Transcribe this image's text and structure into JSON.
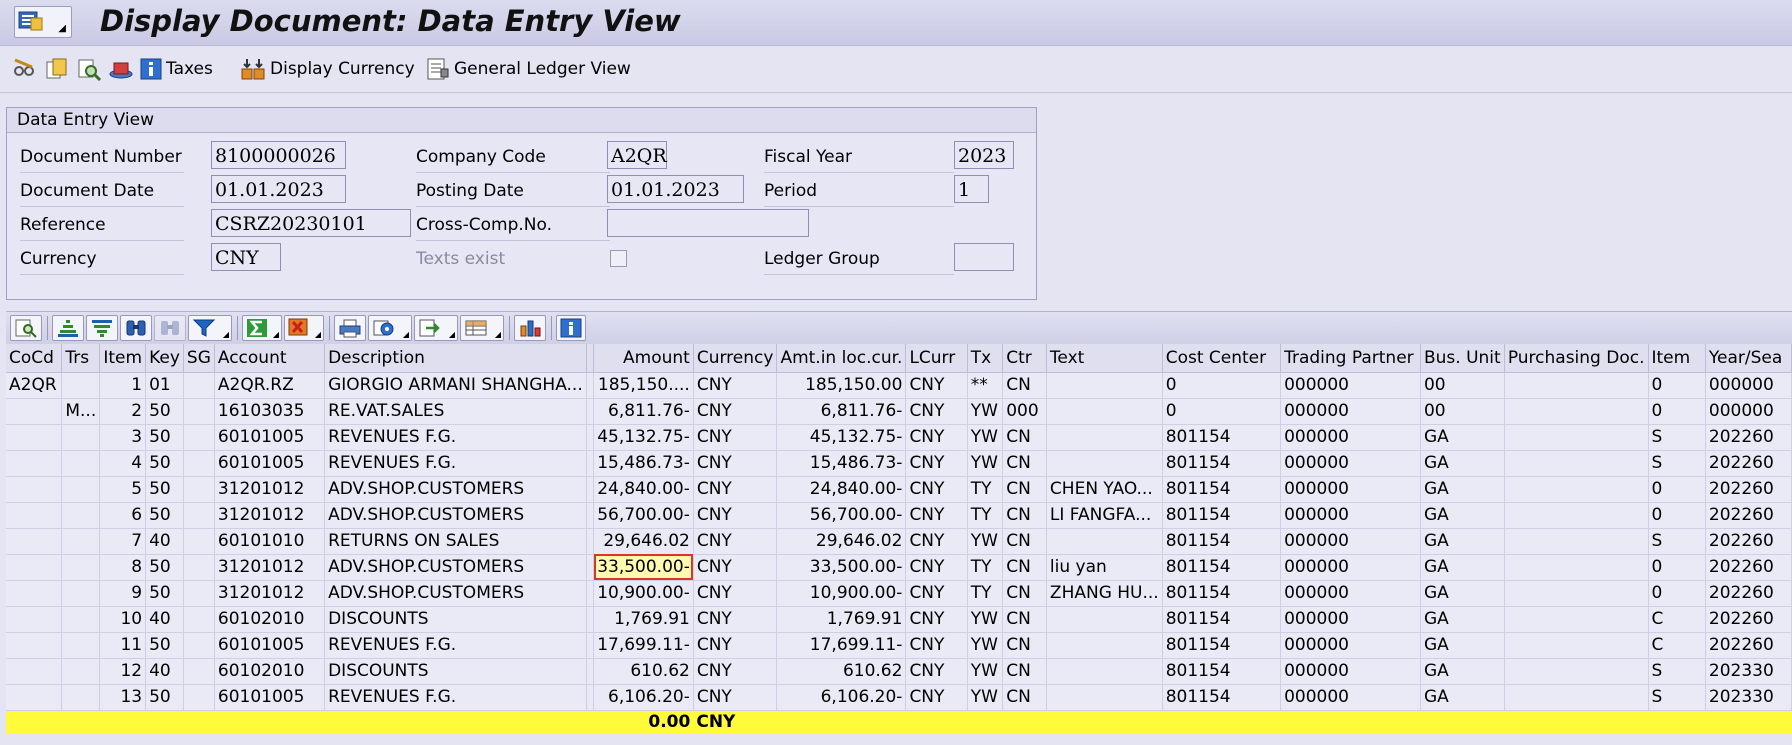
{
  "title": "Display Document: Data Entry View",
  "app_toolbar": {
    "taxes_label": "Taxes",
    "display_currency_label": "Display Currency",
    "general_ledger_view_label": "General Ledger View"
  },
  "header_panel": {
    "title": "Data Entry View",
    "fields": {
      "document_number": {
        "label": "Document Number",
        "value": "8100000026"
      },
      "company_code": {
        "label": "Company Code",
        "value": "A2QR"
      },
      "fiscal_year": {
        "label": "Fiscal Year",
        "value": "2023"
      },
      "document_date": {
        "label": "Document Date",
        "value": "01.01.2023"
      },
      "posting_date": {
        "label": "Posting Date",
        "value": "01.01.2023"
      },
      "period": {
        "label": "Period",
        "value": "1"
      },
      "reference": {
        "label": "Reference",
        "value": "CSRZ20230101"
      },
      "cross_comp_no": {
        "label": "Cross-Comp.No.",
        "value": ""
      },
      "currency": {
        "label": "Currency",
        "value": "CNY"
      },
      "texts_exist": {
        "label": "Texts exist"
      },
      "ledger_group": {
        "label": "Ledger Group",
        "value": ""
      }
    }
  },
  "grid": {
    "columns": [
      "CoCd",
      "Trs",
      "Item",
      "Key",
      "SG",
      "Account",
      "Description",
      "",
      "Amount",
      "Currency",
      "Amt.in loc.cur.",
      "LCurr",
      "Tx",
      "Ctr",
      "Text",
      "Cost Center",
      "Trading Partner",
      "Bus. Unit",
      "Purchasing Doc.",
      "Item",
      "Year/Sea"
    ],
    "rows": [
      [
        "A2QR",
        "",
        "1",
        "01",
        "",
        "A2QR.RZ",
        "GIORGIO ARMANI SHANGHA...",
        "",
        "185,150....",
        "CNY",
        "185,150.00",
        "CNY",
        "**",
        "CN",
        "",
        "0",
        "000000",
        "00",
        "",
        "0",
        "000000"
      ],
      [
        "",
        "M...",
        "2",
        "50",
        "",
        "16103035",
        "RE.VAT.SALES",
        "",
        "6,811.76-",
        "CNY",
        "6,811.76-",
        "CNY",
        "YW",
        "000",
        "",
        "0",
        "000000",
        "00",
        "",
        "0",
        "000000"
      ],
      [
        "",
        "",
        "3",
        "50",
        "",
        "60101005",
        "REVENUES F.G.",
        "",
        "45,132.75-",
        "CNY",
        "45,132.75-",
        "CNY",
        "YW",
        "CN",
        "",
        "801154",
        "000000",
        "GA",
        "",
        "S",
        "202260"
      ],
      [
        "",
        "",
        "4",
        "50",
        "",
        "60101005",
        "REVENUES F.G.",
        "",
        "15,486.73-",
        "CNY",
        "15,486.73-",
        "CNY",
        "YW",
        "CN",
        "",
        "801154",
        "000000",
        "GA",
        "",
        "S",
        "202260"
      ],
      [
        "",
        "",
        "5",
        "50",
        "",
        "31201012",
        "ADV.SHOP.CUSTOMERS",
        "",
        "24,840.00-",
        "CNY",
        "24,840.00-",
        "CNY",
        "TY",
        "CN",
        "CHEN YAO...",
        "801154",
        "000000",
        "GA",
        "",
        "0",
        "202260"
      ],
      [
        "",
        "",
        "6",
        "50",
        "",
        "31201012",
        "ADV.SHOP.CUSTOMERS",
        "",
        "56,700.00-",
        "CNY",
        "56,700.00-",
        "CNY",
        "TY",
        "CN",
        "LI FANGFA...",
        "801154",
        "000000",
        "GA",
        "",
        "0",
        "202260"
      ],
      [
        "",
        "",
        "7",
        "40",
        "",
        "60101010",
        "RETURNS ON SALES",
        "",
        "29,646.02",
        "CNY",
        "29,646.02",
        "CNY",
        "YW",
        "CN",
        "",
        "801154",
        "000000",
        "GA",
        "",
        "S",
        "202260"
      ],
      [
        "",
        "",
        "8",
        "50",
        "",
        "31201012",
        "ADV.SHOP.CUSTOMERS",
        "",
        "33,500.00-",
        "CNY",
        "33,500.00-",
        "CNY",
        "TY",
        "CN",
        "liu yan",
        "801154",
        "000000",
        "GA",
        "",
        "0",
        "202260"
      ],
      [
        "",
        "",
        "9",
        "50",
        "",
        "31201012",
        "ADV.SHOP.CUSTOMERS",
        "",
        "10,900.00-",
        "CNY",
        "10,900.00-",
        "CNY",
        "TY",
        "CN",
        "ZHANG HU...",
        "801154",
        "000000",
        "GA",
        "",
        "0",
        "202260"
      ],
      [
        "",
        "",
        "10",
        "40",
        "",
        "60102010",
        "DISCOUNTS",
        "",
        "1,769.91",
        "CNY",
        "1,769.91",
        "CNY",
        "YW",
        "CN",
        "",
        "801154",
        "000000",
        "GA",
        "",
        "C",
        "202260"
      ],
      [
        "",
        "",
        "11",
        "50",
        "",
        "60101005",
        "REVENUES F.G.",
        "",
        "17,699.11-",
        "CNY",
        "17,699.11-",
        "CNY",
        "YW",
        "CN",
        "",
        "801154",
        "000000",
        "GA",
        "",
        "C",
        "202260"
      ],
      [
        "",
        "",
        "12",
        "40",
        "",
        "60102010",
        "DISCOUNTS",
        "",
        "610.62",
        "CNY",
        "610.62",
        "CNY",
        "YW",
        "CN",
        "",
        "801154",
        "000000",
        "GA",
        "",
        "S",
        "202330"
      ],
      [
        "",
        "",
        "13",
        "50",
        "",
        "60101005",
        "REVENUES F.G.",
        "",
        "6,106.20-",
        "CNY",
        "6,106.20-",
        "CNY",
        "YW",
        "CN",
        "",
        "801154",
        "000000",
        "GA",
        "",
        "S",
        "202330"
      ]
    ],
    "total": {
      "amount": "0.00",
      "currency": "CNY"
    }
  }
}
